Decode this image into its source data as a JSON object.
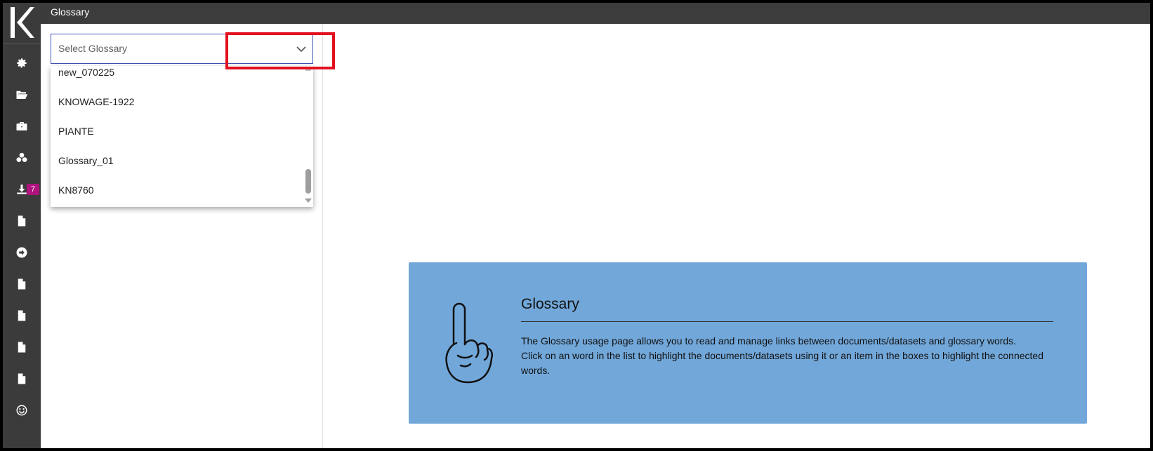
{
  "app": {
    "title": "Glossary"
  },
  "sidebar": {
    "logo_icon": "knowage-logo",
    "items": [
      {
        "icon": "gear-icon"
      },
      {
        "icon": "folder-open-icon"
      },
      {
        "icon": "briefcase-icon"
      },
      {
        "icon": "cubes-icon"
      },
      {
        "icon": "download-icon",
        "badge": "7"
      },
      {
        "icon": "file-icon"
      },
      {
        "icon": "arrow-circle-right-icon"
      },
      {
        "icon": "file-icon"
      },
      {
        "icon": "file-icon"
      },
      {
        "icon": "file-icon"
      },
      {
        "icon": "file-icon"
      },
      {
        "icon": "smile-icon"
      }
    ],
    "badge_color": "#b0127e"
  },
  "glossary_select": {
    "placeholder": "Select Glossary",
    "options": [
      "new_070225",
      "KNOWAGE-1922",
      "PIANTE",
      "Glossary_01",
      "KN8760"
    ]
  },
  "info": {
    "title": "Glossary",
    "line1": "The Glossary usage page allows you to read and manage links between documents/datasets and glossary words.",
    "line2": "Click on an word in the list to highlight the documents/datasets using it or an item in the boxes to highlight the connected words.",
    "background": "#72a7d9"
  },
  "colors": {
    "highlight_box": "#e3111f",
    "select_border": "#3f51b5",
    "topbar": "#3c3c3c"
  }
}
